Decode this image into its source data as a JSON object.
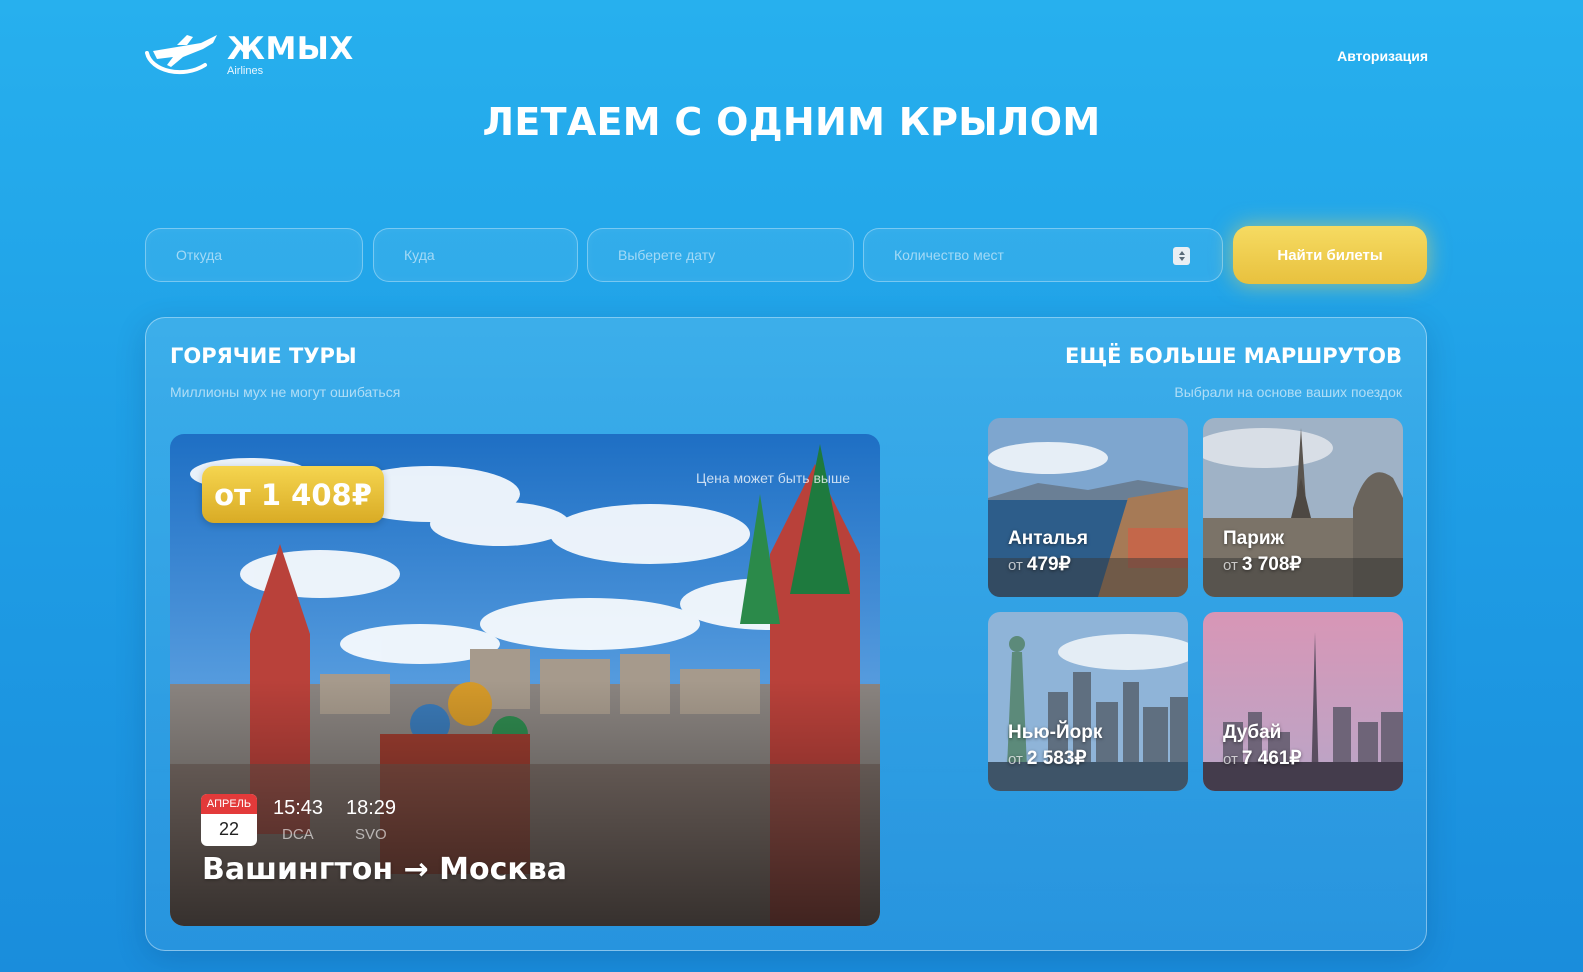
{
  "header": {
    "logo_title": "ЖМЫХ",
    "logo_subtitle": "Airlines",
    "auth_link": "Авторизация"
  },
  "hero": {
    "title": "ЛЕТАЕМ С ОДНИМ КРЫЛОМ"
  },
  "search": {
    "from_placeholder": "Откуда",
    "to_placeholder": "Куда",
    "date_placeholder": "Выберете дату",
    "seats_placeholder": "Количество мест",
    "submit_label": "Найти билеты"
  },
  "hot_tours": {
    "title": "ГОРЯЧИЕ ТУРЫ",
    "subtitle": "Миллионы мух не могут ошибаться",
    "card": {
      "price": "от 1 408₽",
      "price_note": "Цена может быть выше",
      "month": "АПРЕЛЬ",
      "day": "22",
      "depart_time": "15:43",
      "depart_code": "DCA",
      "arrive_time": "18:29",
      "arrive_code": "SVO",
      "route": "Вашингтон → Москва"
    }
  },
  "more_routes": {
    "title": "ЕЩЁ БОЛЬШЕ МАРШРУТОВ",
    "subtitle": "Выбрали на основе ваших поездок",
    "from_prefix": "от",
    "items": [
      {
        "name": "Анталья",
        "price": "479₽"
      },
      {
        "name": "Париж",
        "price": "3 708₽"
      },
      {
        "name": "Нью-Йорк",
        "price": "2 583₽"
      },
      {
        "name": "Дубай",
        "price": "7 461₽"
      }
    ]
  },
  "colors": {
    "background": "#23a6ea",
    "accent_gold": "#f0cc45",
    "calendar_red": "#e33a3a"
  }
}
